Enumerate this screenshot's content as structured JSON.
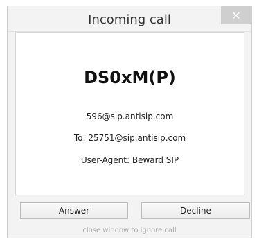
{
  "window": {
    "title": "Incoming call",
    "close_glyph": "✕"
  },
  "call": {
    "caller_name": "DS0xM(P)",
    "sip_address": "596@sip.antisip.com",
    "to_line": "To: 25751@sip.antisip.com",
    "user_agent_line": "User-Agent: Beward SIP"
  },
  "actions": {
    "answer_label": "Answer",
    "decline_label": "Decline"
  },
  "footer": {
    "hint": "close window to ignore call"
  },
  "colors": {
    "window_bg": "#f3f3f3",
    "content_bg": "#ffffff",
    "close_bg": "#cfcfcf"
  },
  "icons": {
    "close": "close-icon"
  }
}
